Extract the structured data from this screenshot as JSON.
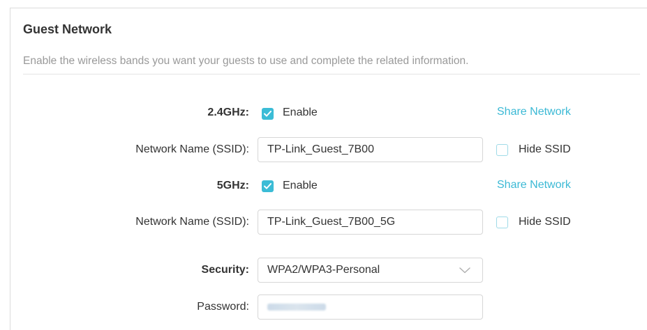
{
  "header": {
    "title": "Guest Network",
    "description": "Enable the wireless bands you want your guests to use and complete the related information."
  },
  "band_24": {
    "label": "2.4GHz:",
    "enable_label": "Enable",
    "enabled": true,
    "share_link": "Share Network",
    "ssid_label": "Network Name (SSID):",
    "ssid_value": "TP-Link_Guest_7B00",
    "hide_ssid_label": "Hide SSID",
    "hide_ssid": false
  },
  "band_5": {
    "label": "5GHz:",
    "enable_label": "Enable",
    "enabled": true,
    "share_link": "Share Network",
    "ssid_label": "Network Name (SSID):",
    "ssid_value": "TP-Link_Guest_7B00_5G",
    "hide_ssid_label": "Hide SSID",
    "hide_ssid": false
  },
  "security": {
    "label": "Security:",
    "value": "WPA2/WPA3-Personal"
  },
  "password": {
    "label": "Password:",
    "value": "12345678"
  },
  "colors": {
    "accent": "#3bbcd6",
    "link": "#3bb9d5",
    "muted_text": "#999999",
    "checkbox_border": "#9fdbe8"
  }
}
